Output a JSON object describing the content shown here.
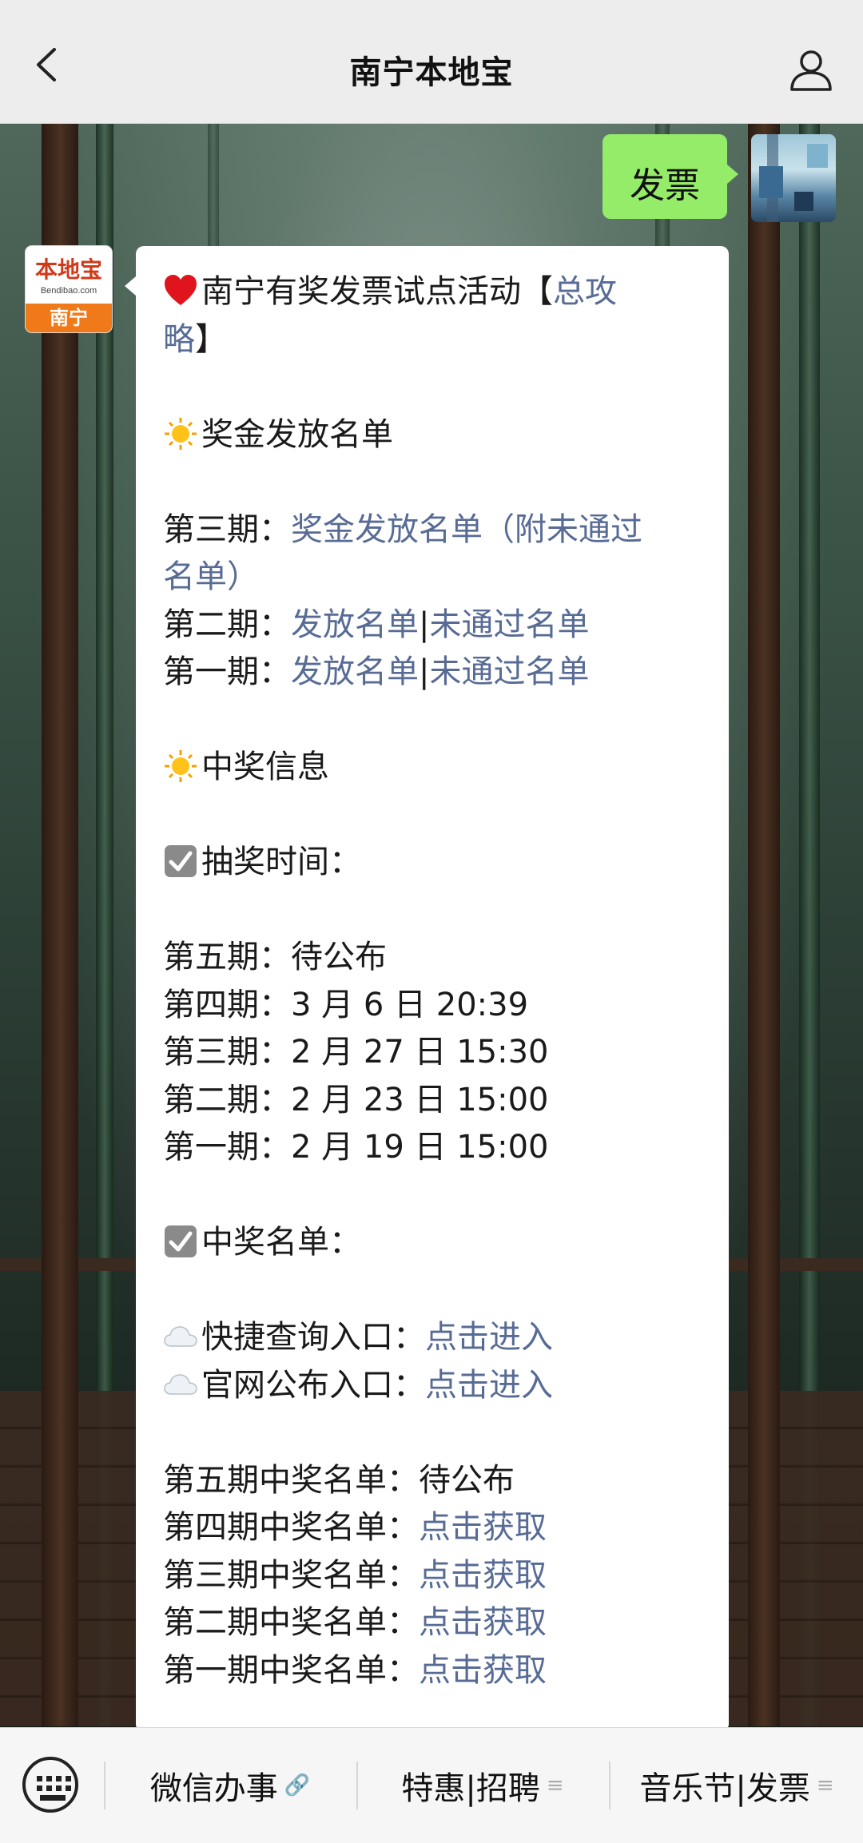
{
  "header": {
    "title": "南宁本地宝"
  },
  "chat": {
    "sent": "发票",
    "brand_avatar": {
      "top": "本地宝",
      "url": "Bendibao.com",
      "bottom": "南宁"
    },
    "message": {
      "l1": {
        "pre": "南宁有奖发票试点活动【",
        "link": "总攻"
      },
      "l2": {
        "link": "略",
        "post": "】"
      },
      "l3": "奖金发放名单",
      "l4": {
        "pre": "第三期：",
        "link": "奖金发放名单（附未通过"
      },
      "l5": {
        "link": "名单）"
      },
      "l6": {
        "pre": "第二期：",
        "link1": "发放名单",
        "sep": "|",
        "link2": "未通过名单"
      },
      "l7": {
        "pre": "第一期：",
        "link1": "发放名单",
        "sep": "|",
        "link2": "未通过名单"
      },
      "l8": "中奖信息",
      "l9": "抽奖时间：",
      "l10": "第五期：待公布",
      "l11": "第四期：3 月 6 日 20:39",
      "l12": "第三期：2 月 27 日 15:30",
      "l13": "第二期：2 月 23 日 15:00",
      "l14": "第一期：2 月 19 日 15:00",
      "l15": "中奖名单：",
      "l16": {
        "pre": "快捷查询入口：",
        "link": "点击进入"
      },
      "l17": {
        "pre": "官网公布入口：",
        "link": "点击进入"
      },
      "l18": "第五期中奖名单：待公布",
      "l19": {
        "pre": "第四期中奖名单：",
        "link": "点击获取"
      },
      "l20": {
        "pre": "第三期中奖名单：",
        "link": "点击获取"
      },
      "l21": {
        "pre": "第二期中奖名单：",
        "link": "点击获取"
      },
      "l22": {
        "pre": "第一期中奖名单：",
        "link": "点击获取"
      }
    }
  },
  "footer": {
    "menus": [
      {
        "label": "微信办事",
        "icon": "link-icon"
      },
      {
        "label": "特惠|招聘",
        "icon": "menu-lines-icon"
      },
      {
        "label": "音乐节|发票",
        "icon": "menu-lines-icon"
      }
    ]
  },
  "colors": {
    "link": "#576b95",
    "sent_bubble": "#95ec69",
    "brand_orange": "#f07a1a"
  }
}
